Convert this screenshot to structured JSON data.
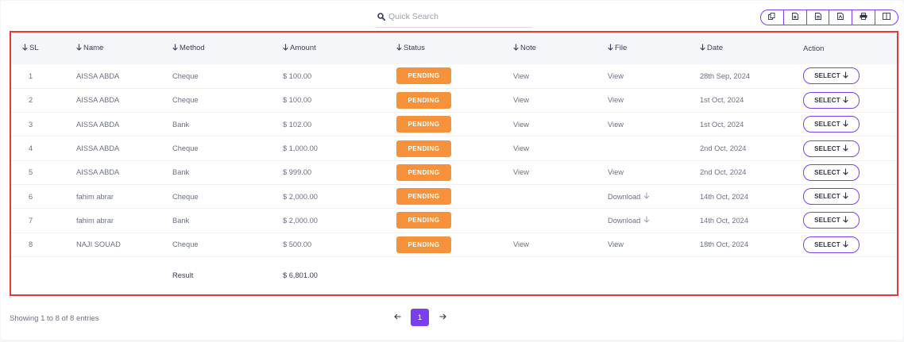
{
  "search": {
    "placeholder": "Quick Search"
  },
  "export_buttons": [
    "copy-icon",
    "excel-icon",
    "csv-icon",
    "pdf-icon",
    "print-icon",
    "columns-icon"
  ],
  "table": {
    "columns": [
      "SL",
      "Name",
      "Method",
      "Amount",
      "Status",
      "Note",
      "File",
      "Date",
      "Action"
    ],
    "rows": [
      {
        "sl": "1",
        "name": "AISSA ABDA",
        "method": "Cheque",
        "amount": "$ 100.00",
        "status": "PENDING",
        "note": "View",
        "file": "View",
        "date": "28th Sep, 2024",
        "action": "SELECT"
      },
      {
        "sl": "2",
        "name": "AISSA ABDA",
        "method": "Cheque",
        "amount": "$ 100.00",
        "status": "PENDING",
        "note": "View",
        "file": "View",
        "date": "1st Oct, 2024",
        "action": "SELECT"
      },
      {
        "sl": "3",
        "name": "AISSA ABDA",
        "method": "Bank",
        "amount": "$ 102.00",
        "status": "PENDING",
        "note": "View",
        "file": "View",
        "date": "1st Oct, 2024",
        "action": "SELECT"
      },
      {
        "sl": "4",
        "name": "AISSA ABDA",
        "method": "Cheque",
        "amount": "$ 1,000.00",
        "status": "PENDING",
        "note": "View",
        "file": "",
        "date": "2nd Oct, 2024",
        "action": "SELECT"
      },
      {
        "sl": "5",
        "name": "AISSA ABDA",
        "method": "Bank",
        "amount": "$ 999.00",
        "status": "PENDING",
        "note": "View",
        "file": "View",
        "date": "2nd Oct, 2024",
        "action": "SELECT"
      },
      {
        "sl": "6",
        "name": "fahim abrar",
        "method": "Cheque",
        "amount": "$ 2,000.00",
        "status": "PENDING",
        "note": "",
        "file": "Download",
        "date": "14th Oct, 2024",
        "action": "SELECT"
      },
      {
        "sl": "7",
        "name": "fahim abrar",
        "method": "Bank",
        "amount": "$ 2,000.00",
        "status": "PENDING",
        "note": "",
        "file": "Download",
        "date": "14th Oct, 2024",
        "action": "SELECT"
      },
      {
        "sl": "8",
        "name": "NAJI SOUAD",
        "method": "Cheque",
        "amount": "$ 500.00",
        "status": "PENDING",
        "note": "View",
        "file": "View",
        "date": "18th Oct, 2024",
        "action": "SELECT"
      }
    ],
    "result": {
      "label": "Result",
      "amount": "$ 6,801.00"
    }
  },
  "footer": {
    "entries_text": "Showing 1 to 8 of 8 entries"
  },
  "pagination": {
    "current_page": "1"
  },
  "colors": {
    "accent": "#7b3ff2",
    "pending": "#f7923a",
    "highlight_border": "#e53935"
  }
}
